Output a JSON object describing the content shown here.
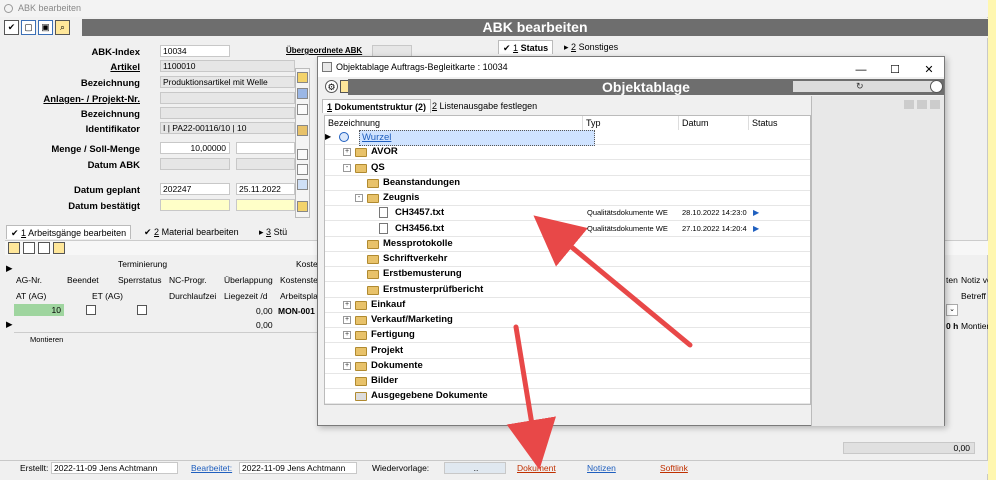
{
  "window": {
    "title": "ABK bearbeiten",
    "header": "ABK bearbeiten"
  },
  "form": {
    "abk_index_label": "ABK-Index",
    "abk_index_value": "10034",
    "parent_label": "Übergeordnete ABK",
    "artikel_label": "Artikel",
    "artikel_value": "1100010",
    "bezeichnung_label": "Bezeichnung",
    "bezeichnung_value": "Produktionsartikel mit Welle",
    "anlagen_label": "Anlagen- / Projekt-Nr.",
    "bezeichnung2_label": "Bezeichnung",
    "identifikator_label": "Identifikator",
    "identifikator_value": "I | PA22-00116/10 | 10",
    "menge_label": "Menge / Soll-Menge",
    "menge_value": "10,00000",
    "datum_abk_label": "Datum ABK",
    "datum_geplant_label": "Datum geplant",
    "datum_geplant_week": "202247",
    "datum_geplant_date": "25.11.2022",
    "datum_bestaetigt_label": "Datum bestätigt"
  },
  "right_tabs": [
    {
      "num": "1",
      "label": "Status"
    },
    {
      "num": "2",
      "label": "Sonstiges"
    }
  ],
  "lower_tabs": [
    {
      "num": "1",
      "label": "Arbeitsgänge bearbeiten"
    },
    {
      "num": "2",
      "label": "Material bearbeiten"
    },
    {
      "num": "3",
      "label": "Stü"
    }
  ],
  "grid": {
    "group_termin": "Terminierung",
    "group_kost": "Koste",
    "headers_row1": [
      "AG-Nr.",
      "Beendet",
      "Sperrstatus",
      "NC-Progr.",
      "Überlappung",
      "Kostenste"
    ],
    "headers_row2": [
      "AT (AG)",
      "ET (AG)",
      "Durchlaufzei",
      "Liegezeit /d",
      "Arbeitspla"
    ],
    "right_headers": [
      "ten",
      "Notiz vo",
      "Betreff"
    ],
    "row1": {
      "ag": "10",
      "ueberlappung": "0,00",
      "kst": "MON-001",
      "right": "0 h",
      "right2": "Montier"
    },
    "row2": {
      "ueberlappung": "0,00"
    },
    "row1_sub": "Montieren",
    "footer_value": "0,00"
  },
  "statusbar": {
    "erstellt_label": "Erstellt:",
    "erstellt_value": "2022-11-09  Jens Achtmann",
    "bearbeitet_label": "Bearbeitet:",
    "bearbeitet_value": "2022-11-09  Jens Achtmann",
    "wiedervorlage_label": "Wiedervorlage:",
    "wiedervorlage_value": "..",
    "dokument": "Dokument",
    "notizen": "Notizen",
    "softlink": "Softlink"
  },
  "dialog": {
    "title": "Objektablage Auftrags-Begleitkarte : 10034",
    "header": "Objektablage",
    "tabs": [
      {
        "num": "1",
        "label": "Dokumentstruktur (2)"
      },
      {
        "num": "2",
        "label": "Listenausgabe festlegen"
      }
    ],
    "columns": [
      "Bezeichnung",
      "Typ",
      "Datum",
      "Status"
    ],
    "rows": [
      {
        "label": "Wurzel",
        "level": 0,
        "kind": "root"
      },
      {
        "label": "AVOR",
        "level": 1,
        "kind": "folder",
        "exp": "+"
      },
      {
        "label": "QS",
        "level": 1,
        "kind": "folder-open",
        "exp": "-"
      },
      {
        "label": "Beanstandungen",
        "level": 2,
        "kind": "folder"
      },
      {
        "label": "Zeugnis",
        "level": 2,
        "kind": "folder-open",
        "exp": "-"
      },
      {
        "label": "CH3457.txt",
        "level": 3,
        "kind": "doc",
        "typ": "Qualitätsdokumente WE",
        "datum": "28.10.2022 14:23:0"
      },
      {
        "label": "CH3456.txt",
        "level": 3,
        "kind": "doc",
        "typ": "Qualitätsdokumente WE",
        "datum": "27.10.2022 14:20:4"
      },
      {
        "label": "Messprotokolle",
        "level": 2,
        "kind": "folder"
      },
      {
        "label": "Schriftverkehr",
        "level": 2,
        "kind": "folder"
      },
      {
        "label": "Erstbemusterung",
        "level": 2,
        "kind": "folder"
      },
      {
        "label": "Erstmusterprüfbericht",
        "level": 2,
        "kind": "folder"
      },
      {
        "label": "Einkauf",
        "level": 1,
        "kind": "folder",
        "exp": "+"
      },
      {
        "label": "Verkauf/Marketing",
        "level": 1,
        "kind": "folder",
        "exp": "+"
      },
      {
        "label": "Fertigung",
        "level": 1,
        "kind": "folder",
        "exp": "+"
      },
      {
        "label": "Projekt",
        "level": 1,
        "kind": "folder"
      },
      {
        "label": "Dokumente",
        "level": 1,
        "kind": "folder",
        "exp": "+"
      },
      {
        "label": "Bilder",
        "level": 1,
        "kind": "folder"
      },
      {
        "label": "Ausgegebene Dokumente",
        "level": 1,
        "kind": "folder-special"
      }
    ]
  },
  "colors": {
    "header_bg": "#6e6e6e",
    "arrow": "#e84848",
    "link": "#1f5fbf",
    "yellow_field": "#ffffc8",
    "green_cell": "#9fd59f"
  }
}
